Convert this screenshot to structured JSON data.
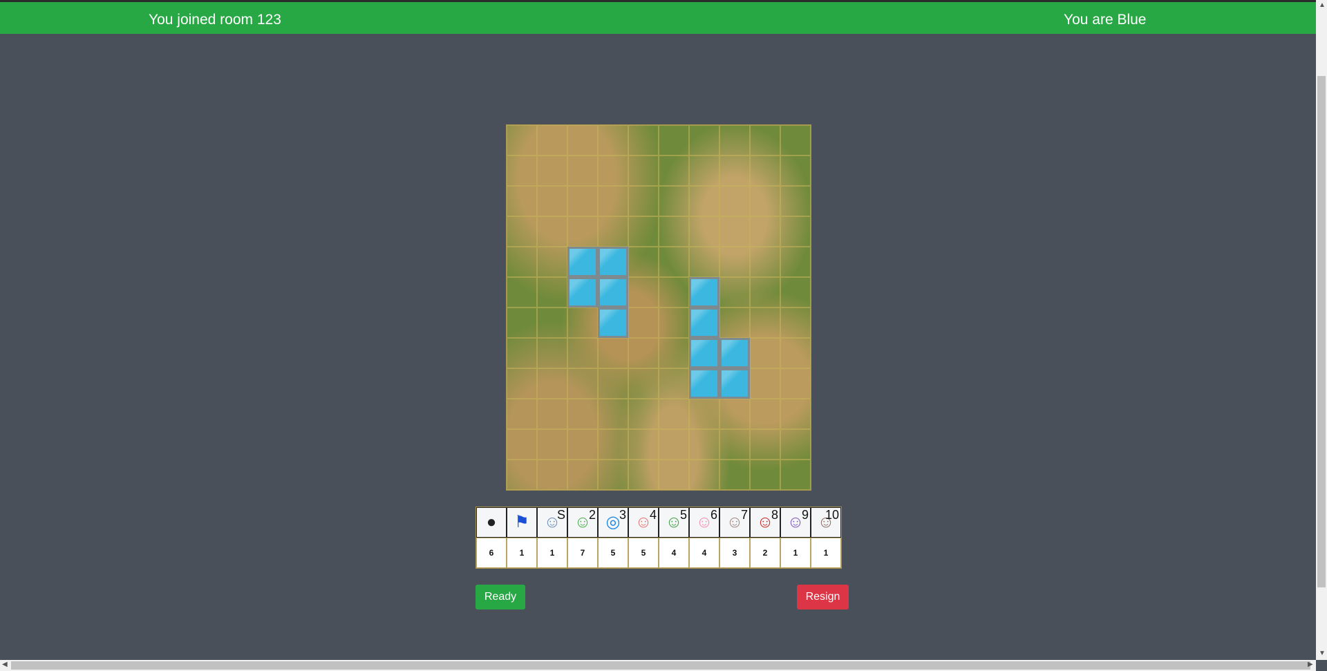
{
  "header": {
    "room_message": "You joined room 123",
    "color_message": "You are Blue"
  },
  "board": {
    "columns": 10,
    "rows": 12,
    "water_cells": [
      [
        4,
        2
      ],
      [
        4,
        3
      ],
      [
        5,
        2
      ],
      [
        5,
        3
      ],
      [
        6,
        3
      ],
      [
        5,
        6
      ],
      [
        6,
        6
      ],
      [
        7,
        6
      ],
      [
        7,
        7
      ],
      [
        8,
        6
      ],
      [
        8,
        7
      ]
    ]
  },
  "pieces": [
    {
      "rank": "",
      "icon": "bomb-icon",
      "count": "6"
    },
    {
      "rank": "",
      "icon": "flag-icon",
      "count": "1"
    },
    {
      "rank": "S",
      "icon": "spy-icon",
      "count": "1"
    },
    {
      "rank": "2",
      "icon": "alien-icon",
      "count": "7"
    },
    {
      "rank": "3",
      "icon": "binoculars-icon",
      "count": "5"
    },
    {
      "rank": "4",
      "icon": "chicken-icon",
      "count": "5"
    },
    {
      "rank": "5",
      "icon": "dinosaur-icon",
      "count": "4"
    },
    {
      "rank": "6",
      "icon": "pig-icon",
      "count": "4"
    },
    {
      "rank": "7",
      "icon": "potato-head-icon",
      "count": "3"
    },
    {
      "rank": "8",
      "icon": "cowgirl-icon",
      "count": "2"
    },
    {
      "rank": "9",
      "icon": "space-ranger-icon",
      "count": "1"
    },
    {
      "rank": "10",
      "icon": "cowboy-icon",
      "count": "1"
    }
  ],
  "buttons": {
    "ready": "Ready",
    "resign": "Resign"
  }
}
